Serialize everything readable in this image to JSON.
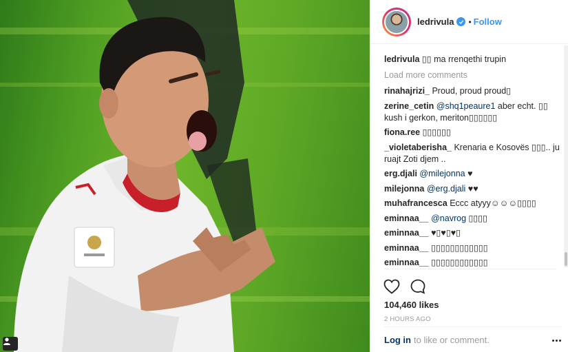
{
  "post": {
    "username": "ledrivula",
    "follow_label": "Follow",
    "dot": "•",
    "caption_user": "ledrivula",
    "caption_text": " ▯▯ ma rrenqethi trupin",
    "load_more": "Load more comments",
    "comments": [
      {
        "user": "rinahajrizi_",
        "parts": [
          {
            "t": " Proud, proud proud▯",
            "m": false
          }
        ]
      },
      {
        "user": "zerine_cetin",
        "parts": [
          {
            "t": " ",
            "m": false
          },
          {
            "t": "@shq1peaure1",
            "m": true
          },
          {
            "t": " aber echt. ▯▯ kush i gerkon, meriton▯▯▯▯▯▯",
            "m": false
          }
        ]
      },
      {
        "user": "fiona.ree",
        "parts": [
          {
            "t": " ▯▯▯▯▯▯",
            "m": false
          }
        ]
      },
      {
        "user": "_violetaberisha_",
        "parts": [
          {
            "t": " Krenaria e Kosovës ▯▯▯.. ju ruajt Zoti djem ..",
            "m": false
          }
        ]
      },
      {
        "user": "erg.djali",
        "parts": [
          {
            "t": " ",
            "m": false
          },
          {
            "t": "@milejonna",
            "m": true
          },
          {
            "t": " ♥",
            "m": false
          }
        ]
      },
      {
        "user": "milejonna",
        "parts": [
          {
            "t": " ",
            "m": false
          },
          {
            "t": "@erg.djali",
            "m": true
          },
          {
            "t": " ♥♥",
            "m": false
          }
        ]
      },
      {
        "user": "muhafrancesca",
        "parts": [
          {
            "t": " Eccc atyyy☺☺☺▯▯▯▯",
            "m": false
          }
        ]
      },
      {
        "user": "eminnaa__",
        "parts": [
          {
            "t": " ",
            "m": false
          },
          {
            "t": "@navrog",
            "m": true
          },
          {
            "t": " ▯▯▯▯",
            "m": false
          }
        ]
      },
      {
        "user": "eminnaa__",
        "parts": [
          {
            "t": " ♥▯♥▯♥▯",
            "m": false
          }
        ]
      },
      {
        "user": "eminnaa__",
        "parts": [
          {
            "t": " ▯▯▯▯▯▯▯▯▯▯▯▯",
            "m": false
          }
        ]
      },
      {
        "user": "eminnaa__",
        "parts": [
          {
            "t": " ▯▯▯▯▯▯▯▯▯▯▯▯",
            "m": false
          }
        ]
      }
    ],
    "likes": "104,460 likes",
    "time": "2 HOURS AGO",
    "login_link": "Log in",
    "login_text": "to like or comment.",
    "icons": {
      "like": "heart-icon",
      "comment": "comment-icon",
      "more": "more-options-icon",
      "verified": "verified-badge-icon",
      "user_tag": "user-tag-icon"
    },
    "colors": {
      "link": "#3897f0",
      "mention": "#003569",
      "muted": "#999999",
      "text": "#262626"
    }
  }
}
